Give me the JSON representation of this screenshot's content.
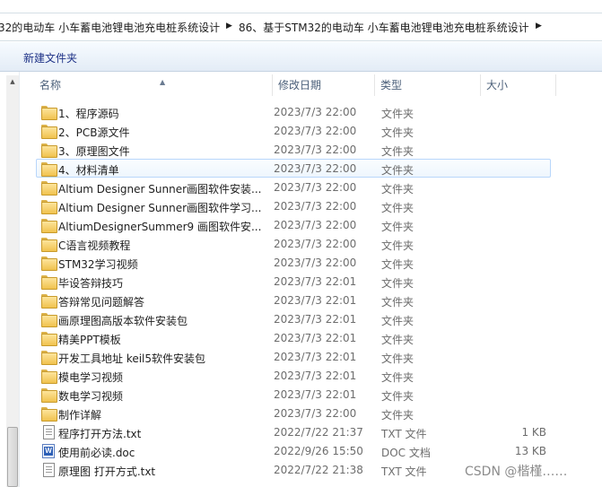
{
  "breadcrumb": [
    "32的电动车 小车蓄电池锂电池充电桩系统设计",
    "86、基于STM32的电动车 小车蓄电池锂电池充电桩系统设计"
  ],
  "toolbar": {
    "new_folder_label": "新建文件夹"
  },
  "columns": {
    "name": "名称",
    "date": "修改日期",
    "type": "类型",
    "size": "大小"
  },
  "rows": [
    {
      "name": "1、程序源码",
      "date": "2023/7/3 22:00",
      "type": "文件夹",
      "size": "",
      "icon": "folder-icon"
    },
    {
      "name": "2、PCB源文件",
      "date": "2023/7/3 22:00",
      "type": "文件夹",
      "size": "",
      "icon": "folder-icon"
    },
    {
      "name": "3、原理图文件",
      "date": "2023/7/3 22:00",
      "type": "文件夹",
      "size": "",
      "icon": "folder-icon"
    },
    {
      "name": "4、材料清单",
      "date": "2023/7/3 22:00",
      "type": "文件夹",
      "size": "",
      "icon": "folder-icon"
    },
    {
      "name": "Altium Designer Sunner画图软件安装...",
      "date": "2023/7/3 22:00",
      "type": "文件夹",
      "size": "",
      "icon": "folder-icon"
    },
    {
      "name": "Altium Designer Sunner画图软件学习...",
      "date": "2023/7/3 22:00",
      "type": "文件夹",
      "size": "",
      "icon": "folder-icon"
    },
    {
      "name": "AltiumDesignerSummer9 画图软件安...",
      "date": "2023/7/3 22:00",
      "type": "文件夹",
      "size": "",
      "icon": "folder-icon"
    },
    {
      "name": "C语言视频教程",
      "date": "2023/7/3 22:00",
      "type": "文件夹",
      "size": "",
      "icon": "folder-icon"
    },
    {
      "name": "STM32学习视频",
      "date": "2023/7/3 22:00",
      "type": "文件夹",
      "size": "",
      "icon": "folder-icon"
    },
    {
      "name": "毕设答辩技巧",
      "date": "2023/7/3 22:01",
      "type": "文件夹",
      "size": "",
      "icon": "folder-icon"
    },
    {
      "name": "答辩常见问题解答",
      "date": "2023/7/3 22:01",
      "type": "文件夹",
      "size": "",
      "icon": "folder-icon"
    },
    {
      "name": "画原理图高版本软件安装包",
      "date": "2023/7/3 22:01",
      "type": "文件夹",
      "size": "",
      "icon": "folder-icon"
    },
    {
      "name": "精美PPT模板",
      "date": "2023/7/3 22:01",
      "type": "文件夹",
      "size": "",
      "icon": "folder-icon"
    },
    {
      "name": "开发工具地址 keil5软件安装包",
      "date": "2023/7/3 22:01",
      "type": "文件夹",
      "size": "",
      "icon": "folder-icon"
    },
    {
      "name": "模电学习视频",
      "date": "2023/7/3 22:01",
      "type": "文件夹",
      "size": "",
      "icon": "folder-icon"
    },
    {
      "name": "数电学习视频",
      "date": "2023/7/3 22:01",
      "type": "文件夹",
      "size": "",
      "icon": "folder-icon"
    },
    {
      "name": "制作详解",
      "date": "2023/7/3 22:00",
      "type": "文件夹",
      "size": "",
      "icon": "folder-icon"
    },
    {
      "name": "程序打开方法.txt",
      "date": "2022/7/22 21:37",
      "type": "TXT 文件",
      "size": "1 KB",
      "icon": "text-file-icon"
    },
    {
      "name": "使用前必读.doc",
      "date": "2022/9/26 15:50",
      "type": "DOC 文档",
      "size": "13 KB",
      "icon": "word-doc-icon"
    },
    {
      "name": "原理图 打开方式.txt",
      "date": "2022/7/22 21:38",
      "type": "TXT 文件",
      "size": "",
      "icon": "text-file-icon"
    }
  ],
  "watermark": "CSDN @楷槿……"
}
